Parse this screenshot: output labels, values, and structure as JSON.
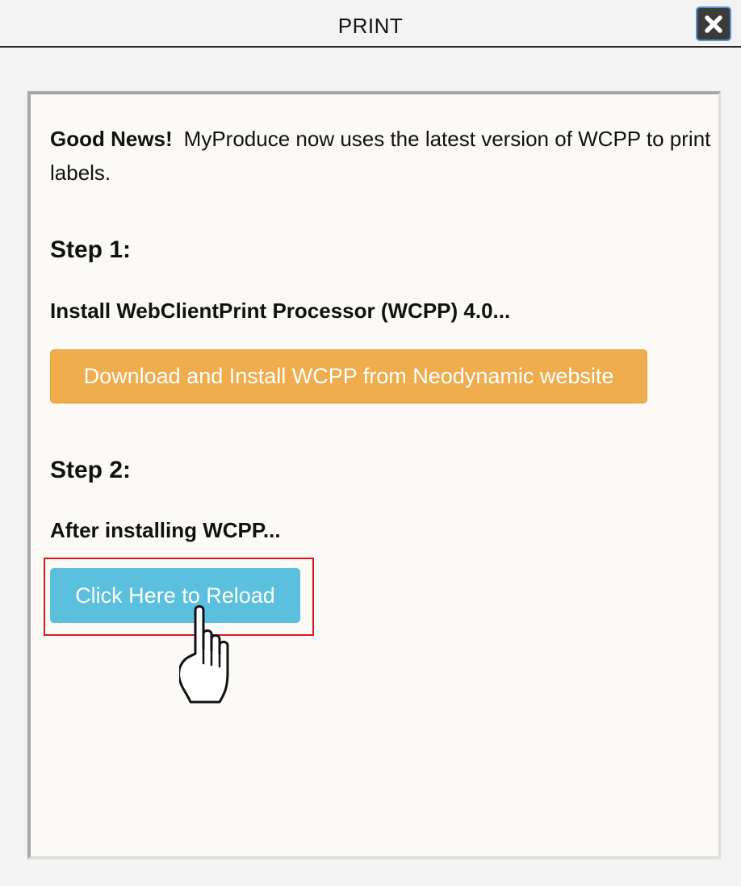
{
  "header": {
    "title": "PRINT",
    "close_icon": "close-icon"
  },
  "content": {
    "intro_bold": "Good News!",
    "intro_text": "MyProduce now uses the latest version of WCPP to print labels.",
    "step1": {
      "heading": "Step 1:",
      "text": "Install WebClientPrint Processor (WCPP) 4.0...",
      "button_label": "Download and Install WCPP from Neodynamic website"
    },
    "step2": {
      "heading": "Step 2:",
      "text": "After installing WCPP...",
      "button_label": "Click Here to Reload"
    }
  },
  "colors": {
    "download_button": "#f0ad4e",
    "reload_button": "#5bc0de",
    "highlight_border": "#e0161d"
  },
  "icons": {
    "pointer": "hand-pointer-icon"
  }
}
